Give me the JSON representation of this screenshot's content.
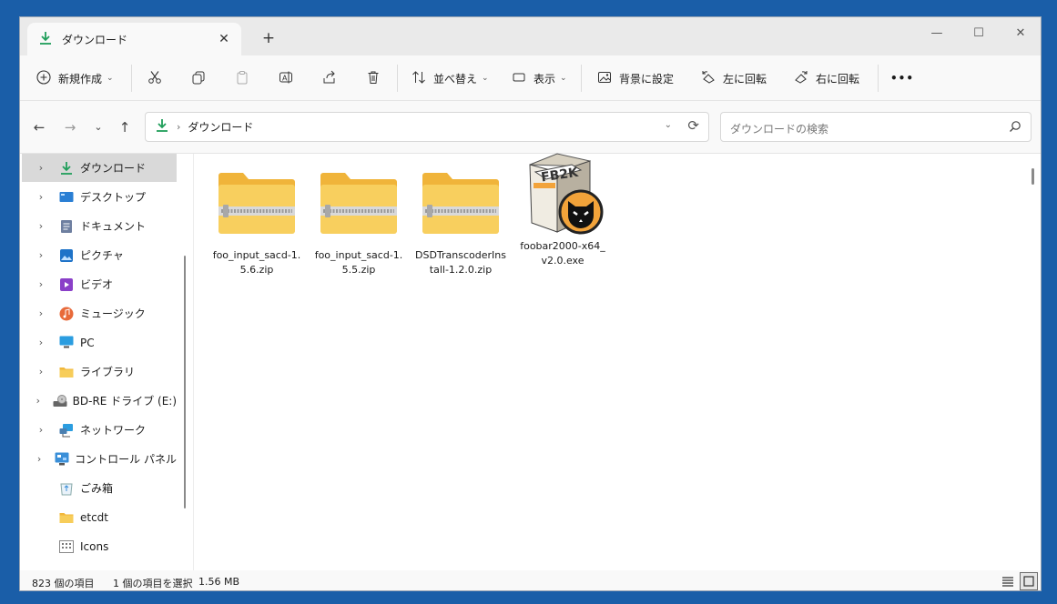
{
  "tab": {
    "title": "ダウンロード",
    "close": "✕",
    "new_tab": "+"
  },
  "window_controls": {
    "minimize": "—",
    "maximize": "☐",
    "close": "✕"
  },
  "toolbar": {
    "new": "新規作成",
    "sort": "並べ替え",
    "view": "表示",
    "set_background": "背景に設定",
    "rotate_left": "左に回転",
    "rotate_right": "右に回転",
    "more": "•••"
  },
  "address": {
    "path": "ダウンロード",
    "search_placeholder": "ダウンロードの検索"
  },
  "sidebar": {
    "items": [
      {
        "label": "ダウンロード",
        "icon": "download-icon",
        "expand": "›"
      },
      {
        "label": "デスクトップ",
        "icon": "desktop-icon",
        "expand": "›"
      },
      {
        "label": "ドキュメント",
        "icon": "document-icon",
        "expand": "›"
      },
      {
        "label": "ピクチャ",
        "icon": "picture-icon",
        "expand": "›"
      },
      {
        "label": "ビデオ",
        "icon": "video-icon",
        "expand": "›"
      },
      {
        "label": "ミュージック",
        "icon": "music-icon",
        "expand": "›"
      },
      {
        "label": "PC",
        "icon": "pc-icon",
        "expand": "›"
      },
      {
        "label": "ライブラリ",
        "icon": "library-icon",
        "expand": "›"
      },
      {
        "label": "BD-RE ドライブ (E:)",
        "icon": "drive-icon",
        "expand": "›"
      },
      {
        "label": "ネットワーク",
        "icon": "network-icon",
        "expand": "›"
      },
      {
        "label": "コントロール パネル",
        "icon": "control-panel-icon",
        "expand": "›"
      },
      {
        "label": "ごみ箱",
        "icon": "recycle-bin-icon",
        "expand": ""
      },
      {
        "label": "etcdt",
        "icon": "folder-icon",
        "expand": ""
      },
      {
        "label": "Icons",
        "icon": "icons-folder-icon",
        "expand": ""
      }
    ]
  },
  "files": [
    {
      "name": "foo_input_sacd-1.5.6.zip",
      "icon": "zip-folder-icon"
    },
    {
      "name": "foo_input_sacd-1.5.5.zip",
      "icon": "zip-folder-icon"
    },
    {
      "name": "DSDTranscoderInstall-1.2.0.zip",
      "icon": "zip-folder-icon"
    },
    {
      "name": "foobar2000-x64_v2.0.exe",
      "icon": "fb2k-installer-icon",
      "badge": "FB2K"
    }
  ],
  "status": {
    "count": "823 個の項目",
    "selected": "1 個の項目を選択",
    "size": "1.56 MB"
  },
  "colors": {
    "accent_green": "#1f9e5a",
    "folder_yellow": "#f7c948",
    "desktop_blue": "#2a7fd4"
  }
}
